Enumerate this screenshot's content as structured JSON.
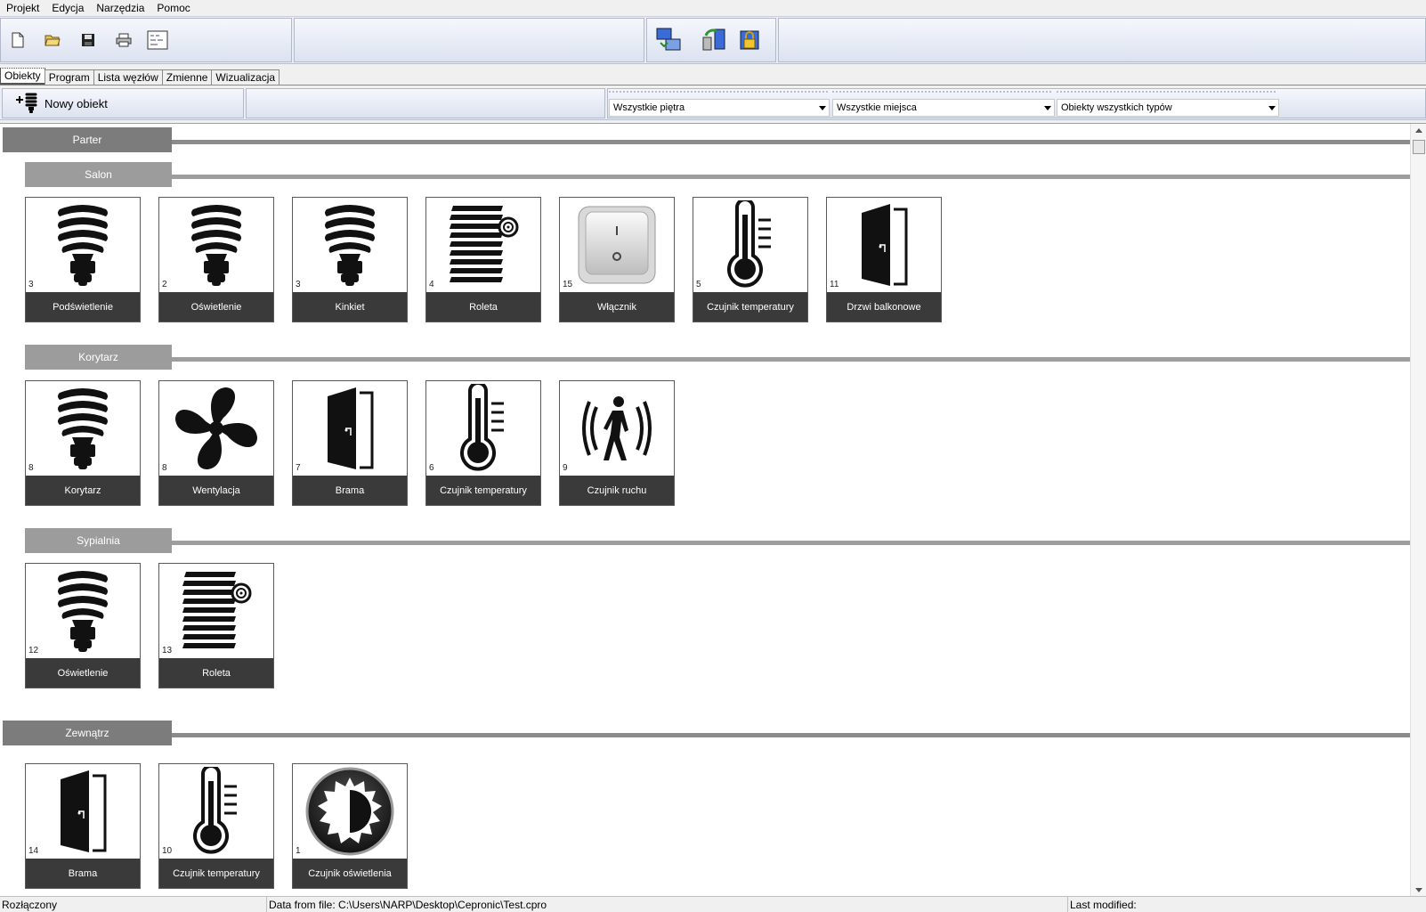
{
  "menu": [
    "Projekt",
    "Edycja",
    "Narzędzia",
    "Pomoc"
  ],
  "toolbar": {
    "left": [
      "new-file-icon",
      "open-folder-icon",
      "save-icon",
      "print-icon",
      "export-icon"
    ],
    "right": [
      "sync-icon",
      "upload-icon",
      "lock-icon"
    ]
  },
  "tabs": [
    "Obiekty",
    "Program",
    "Lista węzłów",
    "Zmienne",
    "Wizualizacja"
  ],
  "active_tab": "Obiekty",
  "filters": {
    "new_object": "Nowy obiekt",
    "floor": "Wszystkie piętra",
    "place": "Wszystkie miejsca",
    "type": "Obiekty wszystkich typów"
  },
  "groups": [
    {
      "name": "Parter",
      "kind": "floor"
    },
    {
      "name": "Salon",
      "kind": "room"
    },
    {
      "name": "Korytarz",
      "kind": "room"
    },
    {
      "name": "Sypialnia",
      "kind": "room"
    },
    {
      "name": "Zewnątrz",
      "kind": "floor"
    }
  ],
  "tiles": {
    "salon": [
      {
        "num": "3",
        "label": "Podświetlenie",
        "icon": "bulb"
      },
      {
        "num": "2",
        "label": "Oświetlenie",
        "icon": "bulb"
      },
      {
        "num": "3",
        "label": "Kinkiet",
        "icon": "bulb"
      },
      {
        "num": "4",
        "label": "Roleta",
        "icon": "blind"
      },
      {
        "num": "15",
        "label": "Włącznik",
        "icon": "switch"
      },
      {
        "num": "5",
        "label": "Czujnik temperatury",
        "icon": "thermo"
      },
      {
        "num": "11",
        "label": "Drzwi balkonowe",
        "icon": "door"
      }
    ],
    "korytarz": [
      {
        "num": "8",
        "label": "Korytarz",
        "icon": "bulb"
      },
      {
        "num": "8",
        "label": "Wentylacja",
        "icon": "fan"
      },
      {
        "num": "7",
        "label": "Brama",
        "icon": "door"
      },
      {
        "num": "6",
        "label": "Czujnik temperatury",
        "icon": "thermo"
      },
      {
        "num": "9",
        "label": "Czujnik ruchu",
        "icon": "motion"
      }
    ],
    "sypialnia": [
      {
        "num": "12",
        "label": "Oświetlenie",
        "icon": "bulb"
      },
      {
        "num": "13",
        "label": "Roleta",
        "icon": "blind"
      }
    ],
    "zewnatrz": [
      {
        "num": "14",
        "label": "Brama",
        "icon": "door"
      },
      {
        "num": "10",
        "label": "Czujnik temperatury",
        "icon": "thermo"
      },
      {
        "num": "1",
        "label": "Czujnik oświetlenia",
        "icon": "light"
      }
    ]
  },
  "status": {
    "connection": "Rozłączony",
    "file": "Data from file: C:\\Users\\NARP\\Desktop\\Cepronic\\Test.cpro",
    "modified": "Last modified:"
  }
}
